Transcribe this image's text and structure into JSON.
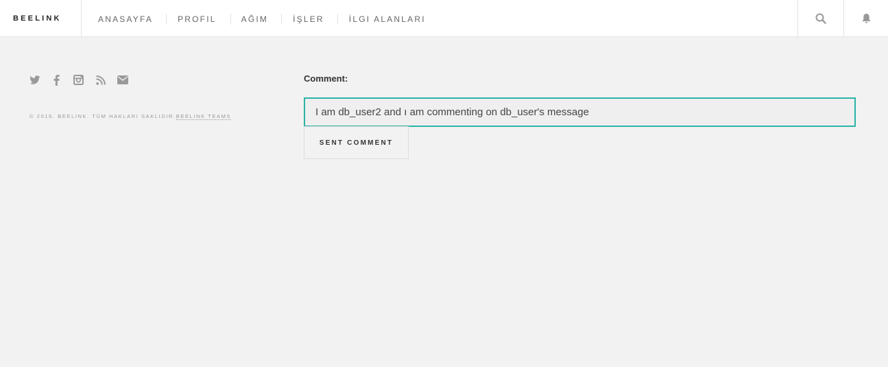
{
  "header": {
    "brand": "BEELINK",
    "nav": [
      "ANASAYFA",
      "PROFIL",
      "AĞIM",
      "İŞLER",
      "İLGI ALANLARI"
    ]
  },
  "footer": {
    "social_icons": [
      "twitter-icon",
      "facebook-icon",
      "instagram-icon",
      "rss-icon",
      "envelope-icon"
    ],
    "copyright_text": "© 2016. BEELINK. TÜM HAKLARI SAKLIDIR.",
    "copyright_link": "BEELINK TEAMS"
  },
  "comment": {
    "label": "Comment:",
    "value": "I am db_user2 and ı am commenting on db_user's message",
    "button": "SENT COMMENT"
  },
  "colors": {
    "accent": "#2ab3a6",
    "background": "#f2f2f2",
    "icon": "#9a9a9a"
  }
}
